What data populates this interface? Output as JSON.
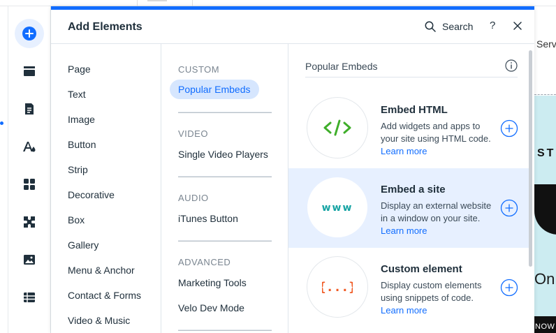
{
  "colors": {
    "accent": "#116dff",
    "selected_bg": "#d6e6fe",
    "hover_bg": "#e7f0ff",
    "embed_html_icon": "#3fae2a",
    "www_icon": "#15a3a3",
    "custom_icon": "#f05a24"
  },
  "panel": {
    "title": "Add Elements",
    "search_label": "Search",
    "help_label": "?"
  },
  "categories": [
    "Page",
    "Text",
    "Image",
    "Button",
    "Strip",
    "Decorative",
    "Box",
    "Gallery",
    "Menu & Anchor",
    "Contact & Forms",
    "Video & Music"
  ],
  "subcategories": {
    "custom": {
      "title": "CUSTOM",
      "items": [
        "Popular Embeds"
      ]
    },
    "video": {
      "title": "VIDEO",
      "items": [
        "Single Video Players"
      ]
    },
    "audio": {
      "title": "AUDIO",
      "items": [
        "iTunes Button"
      ]
    },
    "advanced": {
      "title": "ADVANCED",
      "items": [
        "Marketing Tools",
        "Velo Dev Mode"
      ]
    }
  },
  "content": {
    "section_title": "Popular Embeds",
    "cards": [
      {
        "title": "Embed HTML",
        "desc": "Add widgets and apps to your site using HTML code.",
        "link": "Learn more",
        "icon_text": "</>",
        "icon": "code-icon"
      },
      {
        "title": "Embed a site",
        "desc": "Display an external website in a window on your site.",
        "link": "Learn more",
        "icon_text": "www",
        "icon": "www-icon"
      },
      {
        "title": "Custom element",
        "desc": "Display custom elements using snippets of code.",
        "link": "Learn more",
        "icon_text": "{...}",
        "icon": "braces-icon"
      }
    ]
  },
  "canvas_peek": {
    "text_serv": "Serv",
    "text_st": "ST",
    "text_on": "On",
    "text_now": "NOW"
  }
}
